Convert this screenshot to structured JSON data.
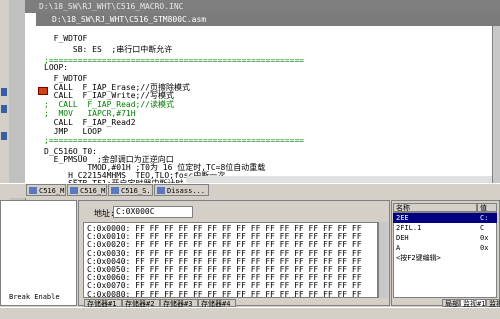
{
  "back_window": {
    "title": "D:\\18_SW\\RJ_WHT\\C516_MACRO.INC"
  },
  "editor_window": {
    "title": "D:\\18_SW\\RJ_WHT\\C516_STM800C.asm",
    "lines": [
      {
        "text": "  F_WDTOF",
        "cls": ""
      },
      {
        "text": "      SB: ES  ;串行口中断允许",
        "cls": ""
      },
      {
        "text": ";=====================================================",
        "cls": "c-comment"
      },
      {
        "text": "LOOP:",
        "cls": ""
      },
      {
        "text": "  F_WDTOF",
        "cls": ""
      },
      {
        "text": "  CALL  F_IAP_Erase;//页擦除模式",
        "cls": ""
      },
      {
        "text": "  CALL  F_IAP_Write;//写模式",
        "cls": ""
      },
      {
        "text": ";  CALL  F_IAP_Read;//读模式",
        "cls": "c-comment"
      },
      {
        "text": ";  MOV   IAPCR,#71H",
        "cls": "c-comment"
      },
      {
        "text": "  CALL  F_IAP_Read2",
        "cls": ""
      },
      {
        "text": "  JMP   LOOP",
        "cls": ""
      },
      {
        "text": ";=====================================================",
        "cls": "c-comment"
      },
      {
        "text": "",
        "cls": ""
      },
      {
        "text": "D_C516O_T0:",
        "cls": ""
      },
      {
        "text": "  E_PMSU0  ;金部调口为正逆向口",
        "cls": ""
      },
      {
        "text": "         TMOD,#01H ;T0为 16 位定时,TC=8位自动重载",
        "cls": ""
      },
      {
        "text": "     H_C22154MHMS  TEO,TLO;fosc中断一次",
        "cls": ""
      },
      {
        "text": "     SETB TF1;开启定时器中断计时.",
        "cls": ""
      }
    ]
  },
  "taskbar": {
    "items": [
      "C516_M...",
      "C516_M...",
      "C516_S...",
      "Disass..."
    ]
  },
  "lower_left": {
    "label": "Break Enable"
  },
  "memory_window": {
    "address_label": "地址:",
    "address_value": "C:0X000C",
    "rows": [
      "C:0x0000: FF FF FF FF FF FF FF FF FF FF FF FF FF FF FF FF",
      "C:0x0010: FF FF FF FF FF FF FF FF FF FF FF FF FF FF FF FF",
      "C:0x0020: FF FF FF FF FF FF FF FF FF FF FF FF FF FF FF FF",
      "C:0x0030: FF FF FF FF FF FF FF FF FF FF FF FF FF FF FF FF",
      "C:0x0040: FF FF FF FF FF FF FF FF FF FF FF FF FF FF FF FF",
      "C:0x0050: FF FF FF FF FF FF FF FF FF FF FF FF FF FF FF FF",
      "C:0x0060: FF FF FF FF FF FF FF FF FF FF FF FF FF FF FF FF",
      "C:0x0070: FF FF FF FF FF FF FF FF FF FF FF FF FF FF FF FF",
      "C:0x0080: FF FF FF FF FF FF FF FF FF FF FF FF FF FF FF FF"
    ],
    "tabs": [
      "存储器#1",
      "存储器#2",
      "存储器#3",
      "存储器#4"
    ]
  },
  "watch_window": {
    "col_name": "名称",
    "col_value": "值",
    "rows": [
      {
        "name": "2EE",
        "value": "C:"
      },
      {
        "name": "2FIL.1",
        "value": "C"
      },
      {
        "name": "DEH",
        "value": "0x"
      },
      {
        "name": "A",
        "value": "0x"
      },
      {
        "name": "<按F2键编辑>",
        "value": ""
      }
    ],
    "tabs": [
      "局部",
      "监视#1",
      "监视#2"
    ]
  }
}
